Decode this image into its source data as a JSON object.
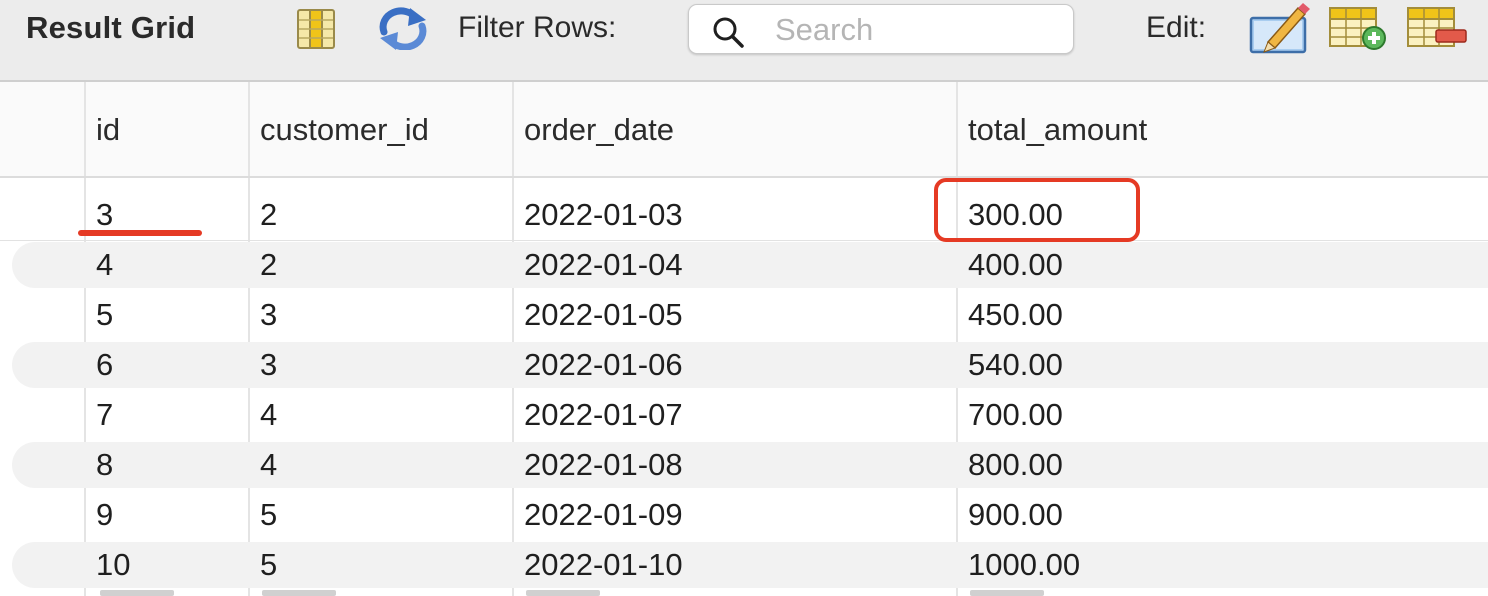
{
  "toolbar": {
    "title": "Result Grid",
    "filter_label": "Filter Rows:",
    "search_placeholder": "Search",
    "search_value": "",
    "edit_label": "Edit:",
    "icons": {
      "columns": "columns-icon",
      "refresh": "refresh-icon",
      "search": "search-icon",
      "edit": "edit-pencil-icon",
      "add_row": "add-row-icon",
      "delete_row": "delete-row-icon"
    }
  },
  "grid": {
    "columns": [
      "id",
      "customer_id",
      "order_date",
      "total_amount"
    ],
    "rows": [
      [
        "3",
        "2",
        "2022-01-03",
        "300.00"
      ],
      [
        "4",
        "2",
        "2022-01-04",
        "400.00"
      ],
      [
        "5",
        "3",
        "2022-01-05",
        "450.00"
      ],
      [
        "6",
        "3",
        "2022-01-06",
        "540.00"
      ],
      [
        "7",
        "4",
        "2022-01-07",
        "700.00"
      ],
      [
        "8",
        "4",
        "2022-01-08",
        "800.00"
      ],
      [
        "9",
        "5",
        "2022-01-09",
        "900.00"
      ],
      [
        "10",
        "5",
        "2022-01-10",
        "1000.00"
      ]
    ]
  },
  "colors": {
    "annotation": "#e53a24",
    "toolbar_bg": "#ececec",
    "row_stripe": "#f2f2f2",
    "refresh_icon": "#3a6fc4"
  }
}
